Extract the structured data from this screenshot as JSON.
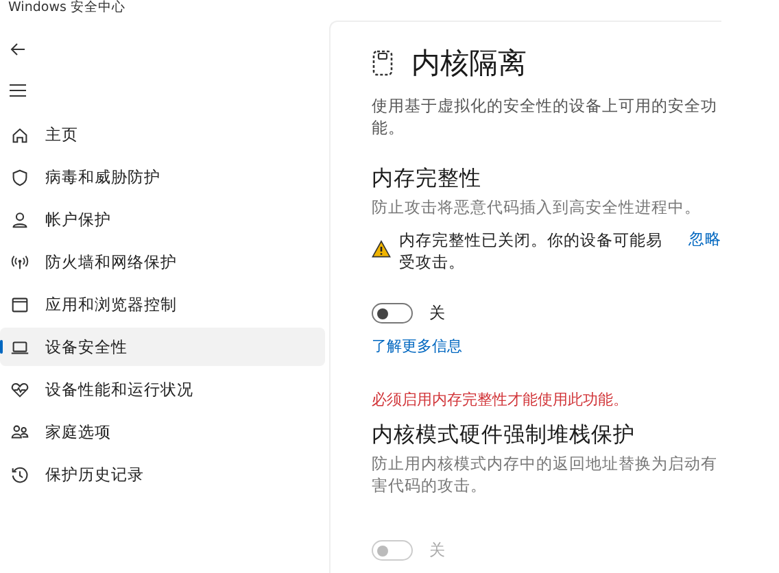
{
  "window": {
    "title": "Windows 安全中心"
  },
  "sidebar": {
    "items": [
      {
        "kind": "home",
        "label": "主页",
        "selected": false
      },
      {
        "kind": "shield",
        "label": "病毒和威胁防护",
        "selected": false
      },
      {
        "kind": "person",
        "label": "帐户保护",
        "selected": false
      },
      {
        "kind": "antenna",
        "label": "防火墙和网络保护",
        "selected": false
      },
      {
        "kind": "window",
        "label": "应用和浏览器控制",
        "selected": false
      },
      {
        "kind": "laptop",
        "label": "设备安全性",
        "selected": true
      },
      {
        "kind": "heart",
        "label": "设备性能和运行状况",
        "selected": false
      },
      {
        "kind": "people",
        "label": "家庭选项",
        "selected": false
      },
      {
        "kind": "history",
        "label": "保护历史记录",
        "selected": false
      }
    ]
  },
  "page": {
    "title": "内核隔离",
    "description": "使用基于虚拟化的安全性的设备上可用的安全功能。",
    "sections": [
      {
        "heading": "内存完整性",
        "description": "防止攻击将恶意代码插入到高安全性进程中。",
        "warning": {
          "text": "内存完整性已关闭。你的设备可能易受攻击。",
          "link": "忽略"
        },
        "toggle": {
          "on": false,
          "disabled": false,
          "label": "关"
        },
        "link": "了解更多信息"
      },
      {
        "notice": "必须启用内存完整性才能使用此功能。",
        "heading": "内核模式硬件强制堆栈保护",
        "description": "防止用内核模式内存中的返回地址替换为启动有害代码的攻击。",
        "toggle": {
          "on": false,
          "disabled": true,
          "label": "关"
        }
      }
    ]
  }
}
